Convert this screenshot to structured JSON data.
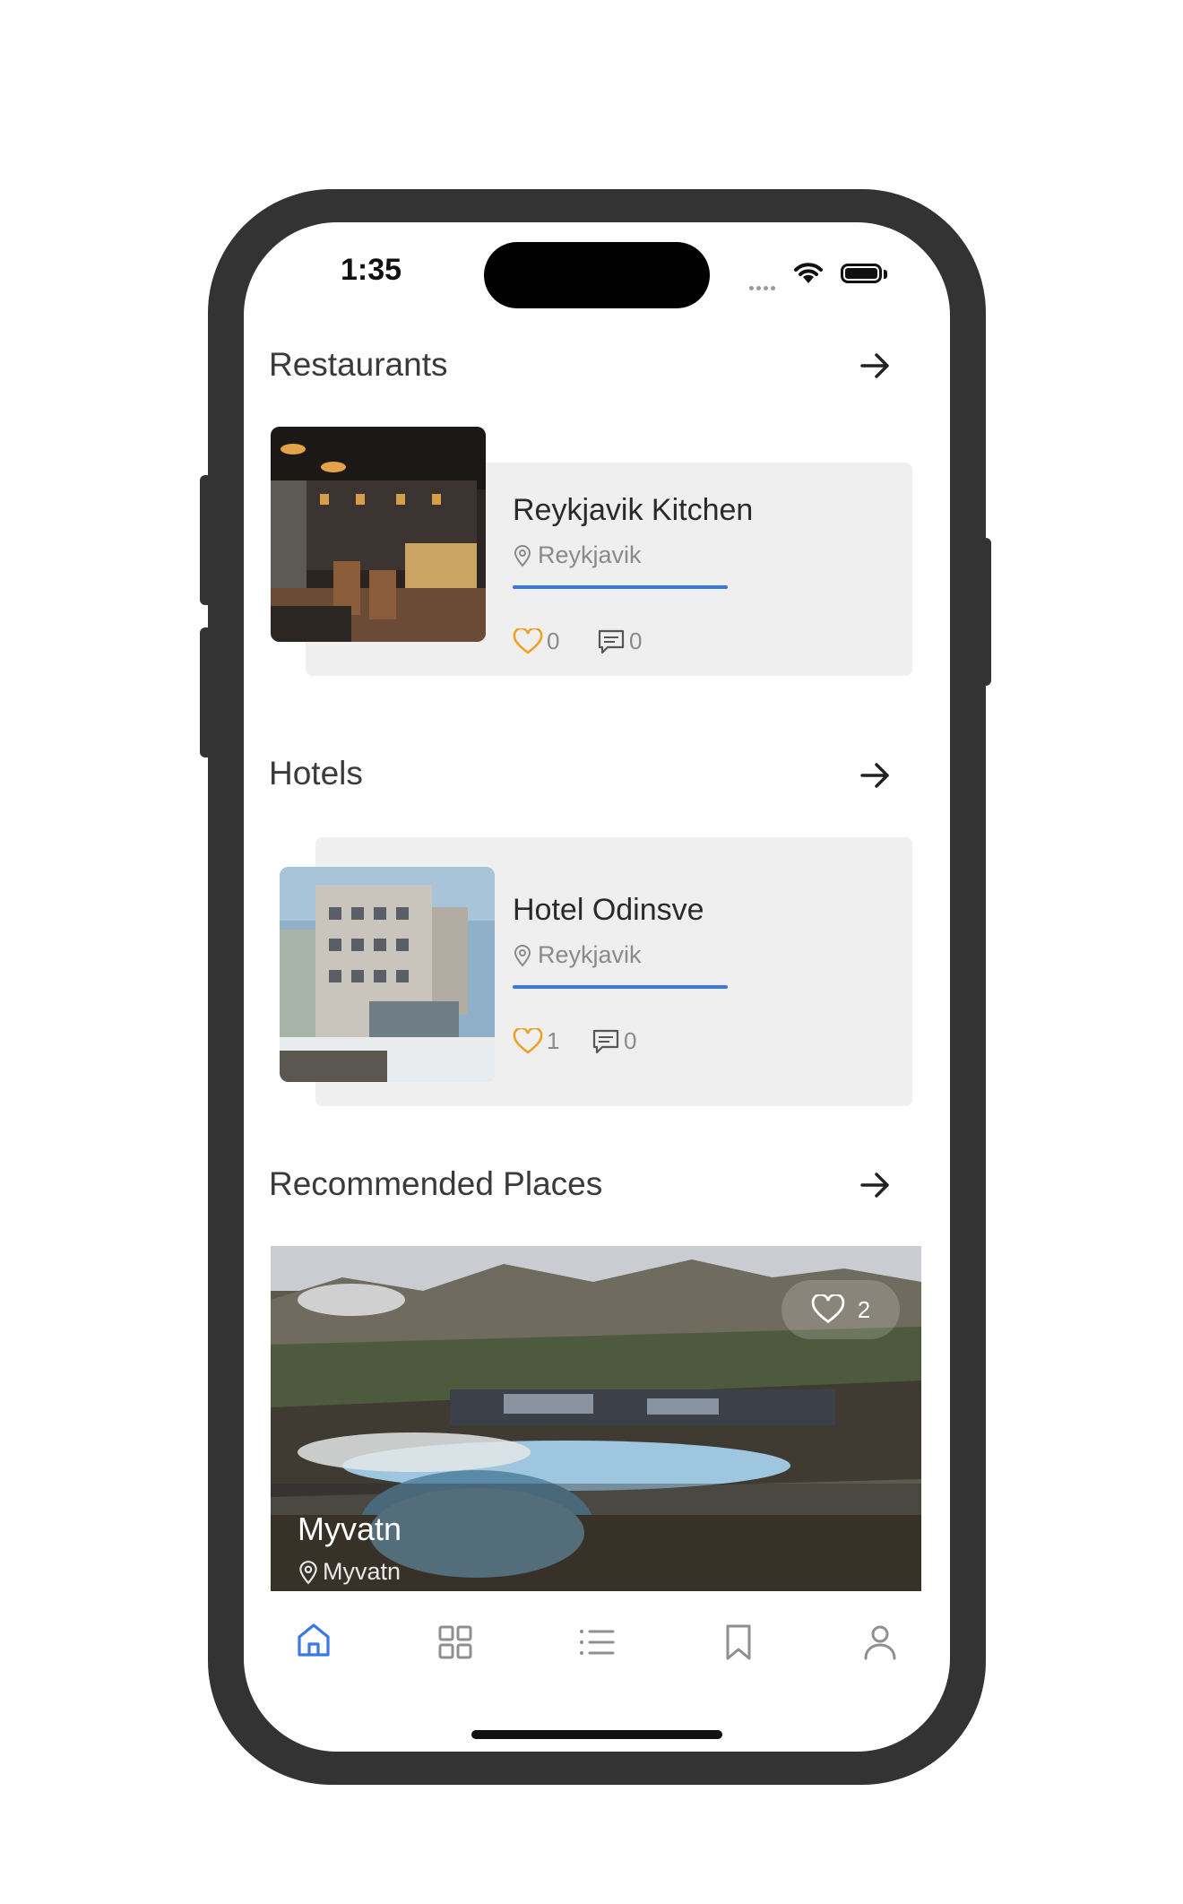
{
  "status": {
    "time": "1:35"
  },
  "sections": {
    "restaurants": {
      "title": "Restaurants",
      "card": {
        "name": "Reykjavik Kitchen",
        "location": "Reykjavik",
        "likes": "0",
        "comments": "0"
      }
    },
    "hotels": {
      "title": "Hotels",
      "card": {
        "name": "Hotel Odinsve",
        "location": "Reykjavik",
        "likes": "1",
        "comments": "0"
      }
    },
    "recommended": {
      "title": "Recommended Places",
      "card": {
        "name": "Myvatn",
        "location": "Myvatn",
        "likes": "2"
      }
    }
  },
  "tabbar": {
    "items": [
      {
        "icon": "home-icon",
        "active": true
      },
      {
        "icon": "grid-icon",
        "active": false
      },
      {
        "icon": "list-icon",
        "active": false
      },
      {
        "icon": "bookmark-icon",
        "active": false
      },
      {
        "icon": "profile-icon",
        "active": false
      }
    ],
    "active_color": "#3a78e6",
    "inactive_color": "#8f8f8f"
  },
  "colors": {
    "accent": "#3a78e6",
    "like": "#f0a020",
    "frame": "#333333",
    "card": "#efefef"
  }
}
